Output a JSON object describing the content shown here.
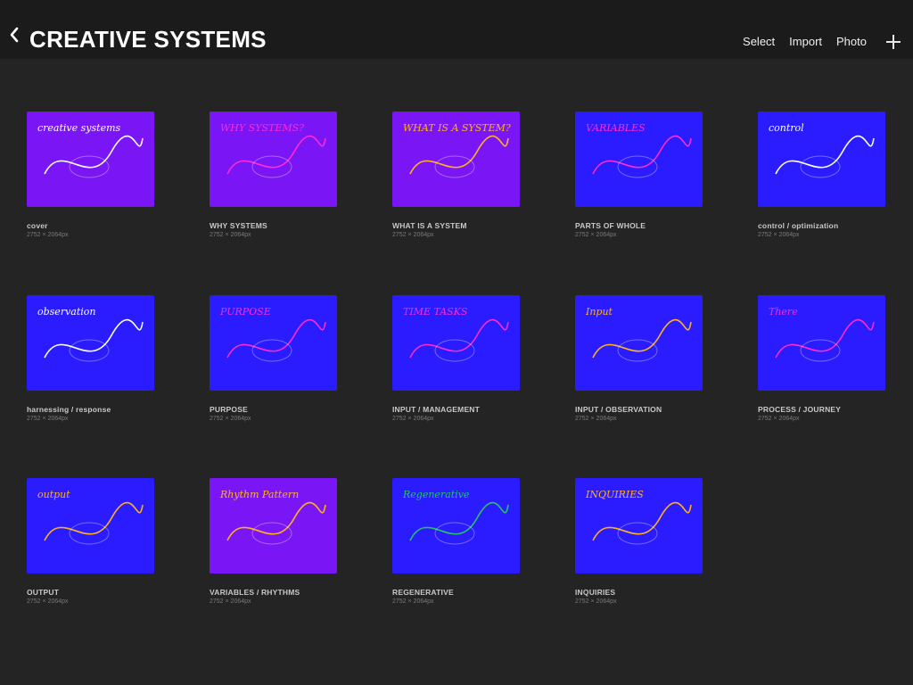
{
  "header": {
    "title": "CREATIVE SYSTEMS",
    "actions": {
      "select": "Select",
      "import": "Import",
      "photo": "Photo"
    }
  },
  "colors": {
    "background": "#242424",
    "topbar": "#1b1b1b",
    "thumb_blue": "#2a1cff",
    "thumb_violet": "#7a16f5",
    "title_text": "#c8c8c8",
    "dims_text": "#7a7a7a"
  },
  "icons": {
    "back": "chevron-left-icon",
    "add": "plus-icon"
  },
  "artworks": [
    {
      "title": "cover",
      "dims": "2752 × 2064px",
      "theme": "violet",
      "text_art": "creative systems"
    },
    {
      "title": "WHY SYSTEMS",
      "dims": "2752 × 2064px",
      "theme": "violet",
      "text_art": "WHY SYSTEMS?"
    },
    {
      "title": "WHAT IS A SYSTEM",
      "dims": "2752 × 2064px",
      "theme": "violet",
      "text_art": "WHAT IS A SYSTEM?"
    },
    {
      "title": "PARTS OF WHOLE",
      "dims": "2752 × 2064px",
      "theme": "blue",
      "text_art": "VARIABLES"
    },
    {
      "title": "control / optimization",
      "dims": "2752 × 2064px",
      "theme": "blue",
      "text_art": "control"
    },
    {
      "title": "harnessing / response",
      "dims": "2752 × 2064px",
      "theme": "blue",
      "text_art": "observation"
    },
    {
      "title": "PURPOSE",
      "dims": "2752 × 2064px",
      "theme": "blue",
      "text_art": "PURPOSE"
    },
    {
      "title": "INPUT / MANAGEMENT",
      "dims": "2752 × 2064px",
      "theme": "blue",
      "text_art": "TIME  TASKS"
    },
    {
      "title": "INPUT / OBSERVATION",
      "dims": "2752 × 2064px",
      "theme": "blue",
      "text_art": "Input"
    },
    {
      "title": "PROCESS / JOURNEY",
      "dims": "2752 × 2064px",
      "theme": "blue",
      "text_art": "There"
    },
    {
      "title": "OUTPUT",
      "dims": "2752 × 2064px",
      "theme": "blue",
      "text_art": "output"
    },
    {
      "title": "VARIABLES / RHYTHMS",
      "dims": "2752 × 2064px",
      "theme": "violet",
      "text_art": "Rhythm Pattern"
    },
    {
      "title": "REGENERATIVE",
      "dims": "2752 × 2064px",
      "theme": "blue",
      "text_art": "Regenerative"
    },
    {
      "title": "INQUIRIES",
      "dims": "2752 × 2064px",
      "theme": "blue",
      "text_art": "INQUIRIES"
    }
  ]
}
